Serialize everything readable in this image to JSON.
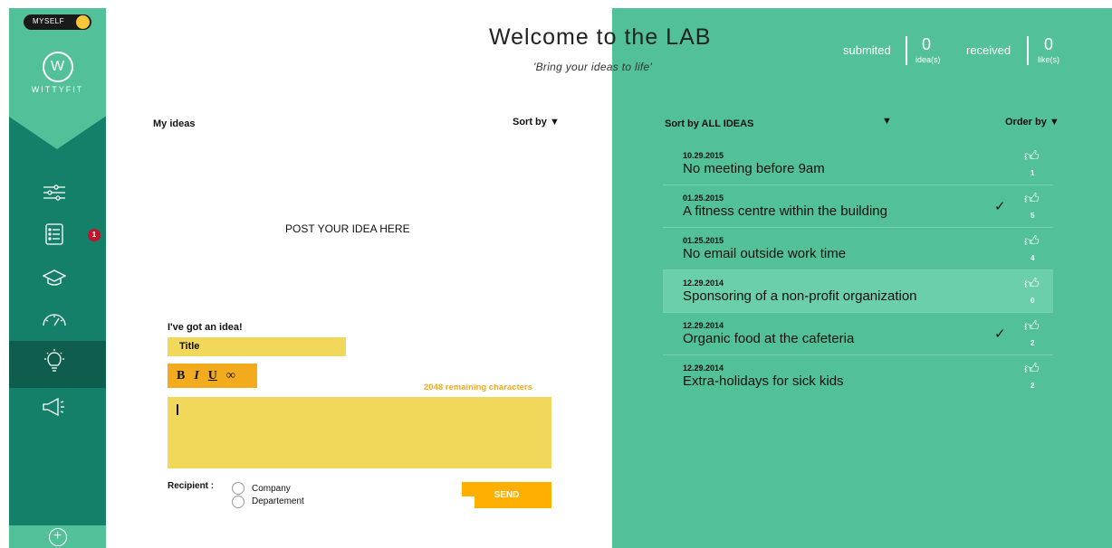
{
  "sidebar": {
    "toggle_label": "MYSELF",
    "logo_glyph": "W",
    "logo_text": "WITTYFIT",
    "notification_count": "1",
    "icons": [
      "settings-sliders-icon",
      "checklist-icon",
      "graduation-cap-icon",
      "speedometer-icon",
      "lightbulb-icon",
      "megaphone-icon"
    ],
    "add_glyph": "+"
  },
  "header": {
    "title": "Welcome to the LAB",
    "tagline": "'Bring your ideas to life'",
    "submitted_label": "submited",
    "submitted_count": "0",
    "submitted_unit": "idea(s)",
    "received_label": "received",
    "received_count": "0",
    "received_unit": "like(s)"
  },
  "my_ideas": {
    "heading": "My ideas",
    "sort_label": "Sort by",
    "post_here": "POST YOUR IDEA HERE",
    "form": {
      "heading": "I've got an idea!",
      "title_placeholder": "Title",
      "bold": "B",
      "italic": "I",
      "underline": "U",
      "link": "∞",
      "remaining": "2048 remaining characters",
      "recipient_label": "Recipient :",
      "recipient_options": [
        "Company",
        "Departement"
      ],
      "send_label": "SEND"
    }
  },
  "all_ideas": {
    "sort_label": "Sort by ALL IDEAS",
    "order_label": "Order by",
    "items": [
      {
        "date": "10.29.2015",
        "title": "No meeting before 9am",
        "likes": "1",
        "liked": false
      },
      {
        "date": "01.25.2015",
        "title": "A fitness centre within the building",
        "likes": "5",
        "liked": true
      },
      {
        "date": "01.25.2015",
        "title": "No email outside work time",
        "likes": "4",
        "liked": false
      },
      {
        "date": "12.29.2014",
        "title": "Sponsoring of a non-profit organization",
        "likes": "0",
        "liked": false
      },
      {
        "date": "12.29.2014",
        "title": "Organic food at the cafeteria",
        "likes": "2",
        "liked": true
      },
      {
        "date": "12.29.2014",
        "title": "Extra-holidays for sick kids",
        "likes": "2",
        "liked": false
      }
    ]
  },
  "colors": {
    "sidebar_dark": "#148069",
    "accent_green": "#52c098",
    "highlight_row": "#6ccfab",
    "yellow_field": "#f2d85a",
    "orange": "#f1ab1d",
    "send": "#ffaf00",
    "badge": "#c0152b"
  }
}
